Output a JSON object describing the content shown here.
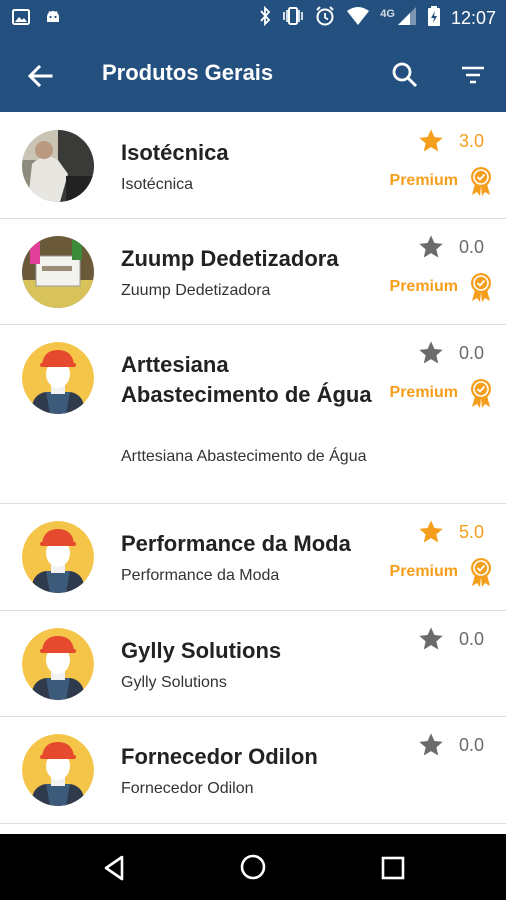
{
  "status_bar": {
    "time": "12:07",
    "network": "4G"
  },
  "app_bar": {
    "title": "Produtos Gerais"
  },
  "items": [
    {
      "title": "Isotécnica",
      "subtitle": "Isotécnica",
      "rating": "3.0",
      "rated": true,
      "premium": "Premium",
      "avatar": "photo-person"
    },
    {
      "title": "Zuump Dedetizadora",
      "subtitle": "Zuump Dedetizadora",
      "rating": "0.0",
      "rated": false,
      "premium": "Premium",
      "avatar": "photo-sign"
    },
    {
      "title": "Arttesiana Abastecimento de Água",
      "subtitle": "Arttesiana Abastecimento de Água",
      "rating": "0.0",
      "rated": false,
      "premium": "Premium",
      "avatar": "worker"
    },
    {
      "title": "Performance da Moda",
      "subtitle": "Performance da Moda",
      "rating": "5.0",
      "rated": true,
      "premium": "Premium",
      "avatar": "worker"
    },
    {
      "title": "Gylly Solutions",
      "subtitle": "Gylly Solutions",
      "rating": "0.0",
      "rated": false,
      "premium": null,
      "avatar": "worker"
    },
    {
      "title": "Fornecedor Odilon",
      "subtitle": "Fornecedor Odilon",
      "rating": "0.0",
      "rated": false,
      "premium": null,
      "avatar": "worker"
    }
  ],
  "colors": {
    "primary": "#24507f",
    "accent": "#f59e1c",
    "star_inactive": "#6b6b6b"
  }
}
